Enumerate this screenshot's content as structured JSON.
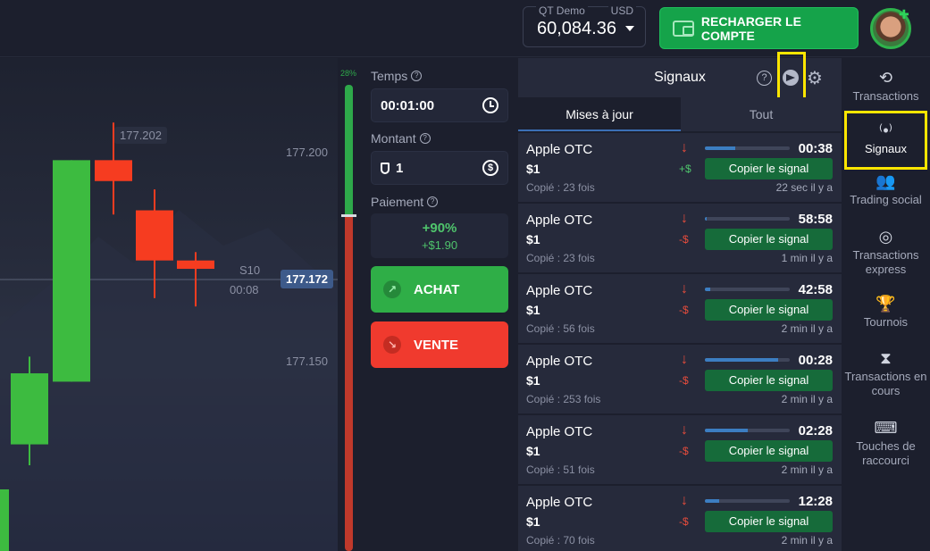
{
  "header": {
    "account_name": "QT Demo",
    "account_currency": "USD",
    "balance": "60,084.36",
    "recharge_label": "RECHARGER LE COMPTE",
    "colors": {
      "recharge": "#15a34a"
    }
  },
  "chart": {
    "hover_price": "177.202",
    "price_label_high": "177.200",
    "price_label_low": "177.150",
    "current_price": "177.172",
    "timer_label": "S10",
    "timer_value": "00:08"
  },
  "chart_data": {
    "type": "candlestick",
    "y_labels": [
      "177.200",
      "177.150"
    ],
    "current_price": 177.172,
    "candles": [
      {
        "direction": "up",
        "open": 177.13,
        "close": 177.147,
        "high": 177.151,
        "low": 177.125
      },
      {
        "direction": "up",
        "open": 177.145,
        "close": 177.198,
        "high": 177.198,
        "low": 177.145
      },
      {
        "direction": "down",
        "open": 177.198,
        "close": 177.193,
        "high": 177.207,
        "low": 177.185
      },
      {
        "direction": "down",
        "open": 177.186,
        "close": 177.174,
        "high": 177.191,
        "low": 177.165
      },
      {
        "direction": "down",
        "open": 177.174,
        "close": 177.172,
        "high": 177.176,
        "low": 177.163
      }
    ]
  },
  "sentiment": {
    "percent_up_label": "28%",
    "percent_up": 28,
    "colors": {
      "up": "#2ea84a",
      "down": "#c0392b"
    }
  },
  "trade": {
    "time_label": "Temps",
    "time_value": "00:01:00",
    "amount_label": "Montant",
    "amount_value": "1",
    "payout_label": "Paiement",
    "payout_percent": "+90%",
    "payout_amount": "+$1.90",
    "buy_label": "ACHAT",
    "sell_label": "VENTE",
    "colors": {
      "buy": "#2fae47",
      "sell": "#f03a2e"
    }
  },
  "signals": {
    "title": "Signaux",
    "tabs": [
      {
        "label": "Mises à jour"
      },
      {
        "label": "Tout"
      }
    ],
    "copy_label": "Copier le signal",
    "items": [
      {
        "asset": "Apple OTC",
        "amount": "$1",
        "copied": "Copié : 23 fois",
        "arrow": "↓",
        "sign": "+$",
        "time": "00:38",
        "ago": "22 sec il y a",
        "progress": 0.36
      },
      {
        "asset": "Apple OTC",
        "amount": "$1",
        "copied": "Copié : 23 fois",
        "arrow": "↓",
        "sign": "-$",
        "time": "58:58",
        "ago": "1 min il y a",
        "progress": 0.02
      },
      {
        "asset": "Apple OTC",
        "amount": "$1",
        "copied": "Copié : 56 fois",
        "arrow": "↓",
        "sign": "-$",
        "time": "42:58",
        "ago": "2 min il y a",
        "progress": 0.06
      },
      {
        "asset": "Apple OTC",
        "amount": "$1",
        "copied": "Copié : 253 fois",
        "arrow": "↓",
        "sign": "-$",
        "time": "00:28",
        "ago": "2 min il y a",
        "progress": 0.86
      },
      {
        "asset": "Apple OTC",
        "amount": "$1",
        "copied": "Copié : 51 fois",
        "arrow": "↓",
        "sign": "-$",
        "time": "02:28",
        "ago": "2 min il y a",
        "progress": 0.5
      },
      {
        "asset": "Apple OTC",
        "amount": "$1",
        "copied": "Copié : 70 fois",
        "arrow": "↓",
        "sign": "-$",
        "time": "12:28",
        "ago": "2 min il y a",
        "progress": 0.17
      }
    ]
  },
  "sidebar": {
    "items": [
      {
        "label": "Transactions",
        "icon": "history-icon"
      },
      {
        "label": "Signaux",
        "icon": "signal-icon"
      },
      {
        "label": "Trading social",
        "icon": "users-icon"
      },
      {
        "label": "Transactions express",
        "icon": "target-icon"
      },
      {
        "label": "Tournois",
        "icon": "trophy-icon"
      },
      {
        "label": "Transactions en cours",
        "icon": "hourglass-icon"
      },
      {
        "label": "Touches de raccourci",
        "icon": "keyboard-icon"
      }
    ]
  }
}
